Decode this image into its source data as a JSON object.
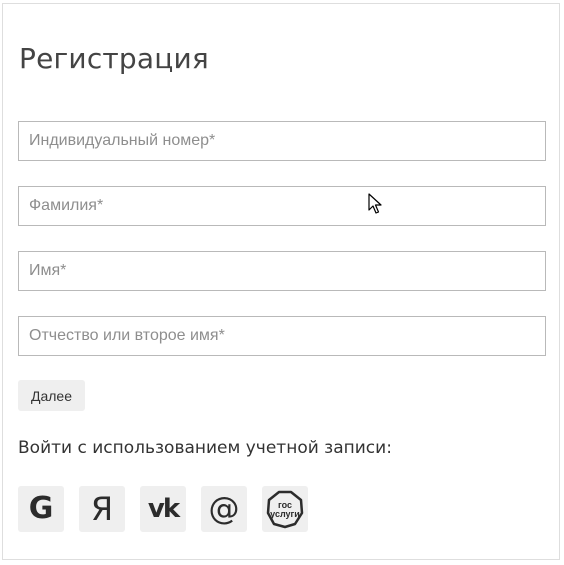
{
  "form": {
    "title": "Регистрация",
    "fields": [
      {
        "placeholder": "Индивидуальный номер*",
        "value": ""
      },
      {
        "placeholder": "Фамилия*",
        "value": ""
      },
      {
        "placeholder": "Имя*",
        "value": ""
      },
      {
        "placeholder": "Отчество или второе имя*",
        "value": ""
      }
    ],
    "next_label": "Далее"
  },
  "social_login": {
    "label": "Войти с использованием учетной записи:",
    "providers": [
      {
        "icon": "google-icon",
        "glyph": "G"
      },
      {
        "icon": "yandex-icon",
        "glyph": "Я"
      },
      {
        "icon": "vk-icon",
        "glyph": "vk"
      },
      {
        "icon": "mail-ru-icon",
        "glyph": "@"
      },
      {
        "icon": "gosuslugi-icon",
        "text_line1": "гос",
        "text_line2": "услуги"
      }
    ]
  },
  "colors": {
    "border": "#b9b9b9",
    "button_bg": "#efefef",
    "icon": "#2c2c2c"
  }
}
